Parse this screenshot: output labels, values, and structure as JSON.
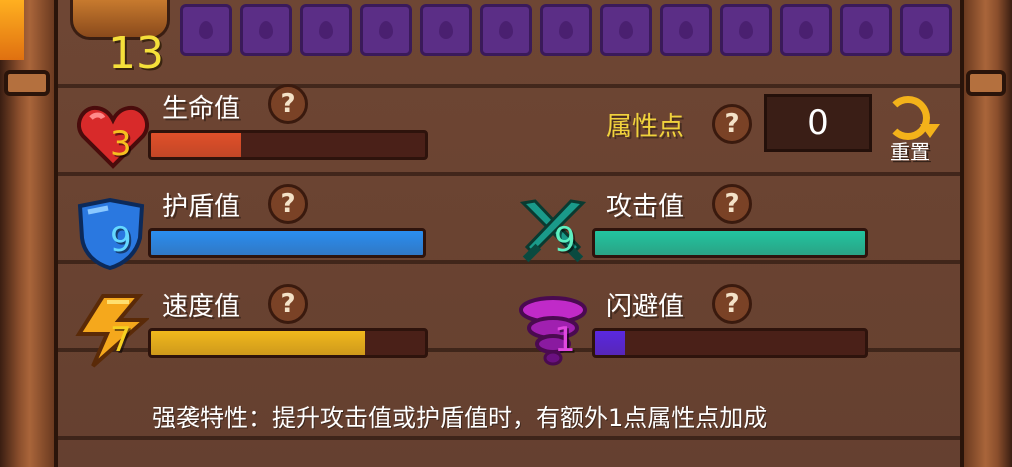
{
  "level": "13",
  "top_slots": [
    {
      "icon": "purple-drop-icon"
    },
    {
      "icon": "purple-drop-icon"
    },
    {
      "icon": "purple-drop-icon"
    },
    {
      "icon": "purple-drop-icon"
    },
    {
      "icon": "purple-drop-icon"
    },
    {
      "icon": "purple-drop-icon"
    },
    {
      "icon": "purple-drop-icon"
    },
    {
      "icon": "purple-drop-icon"
    },
    {
      "icon": "purple-drop-icon"
    },
    {
      "icon": "purple-drop-icon"
    },
    {
      "icon": "purple-drop-icon"
    },
    {
      "icon": "purple-drop-icon"
    },
    {
      "icon": "purple-drop-icon"
    }
  ],
  "attribute_points": {
    "label": "属性点",
    "value": "0",
    "reset_label": "重置"
  },
  "help_glyph": "?",
  "stats": {
    "hp": {
      "label": "生命值",
      "value": "3",
      "icon": "heart-icon",
      "fill_fraction": 0.33,
      "color": "#e0502a",
      "value_color": "#f5c020"
    },
    "shield": {
      "label": "护盾值",
      "value": "9",
      "icon": "shield-icon",
      "fill_fraction": 1.0,
      "color": "#2a8ef0",
      "value_color": "#64d8ff"
    },
    "attack": {
      "label": "攻击值",
      "value": "9",
      "icon": "crossed-swords-icon",
      "fill_fraction": 1.0,
      "color": "#22c4a0",
      "value_color": "#5ef0c0"
    },
    "speed": {
      "label": "速度值",
      "value": "7",
      "icon": "lightning-icon",
      "fill_fraction": 0.78,
      "color": "#f0b81c",
      "value_color": "#f5d020"
    },
    "dodge": {
      "label": "闪避值",
      "value": "1",
      "icon": "tornado-icon",
      "fill_fraction": 0.11,
      "color": "#5a28e0",
      "value_color": "#e048e0"
    }
  },
  "footer_text": "强袭特性：提升攻击值或护盾值时，有额外1点属性点加成"
}
